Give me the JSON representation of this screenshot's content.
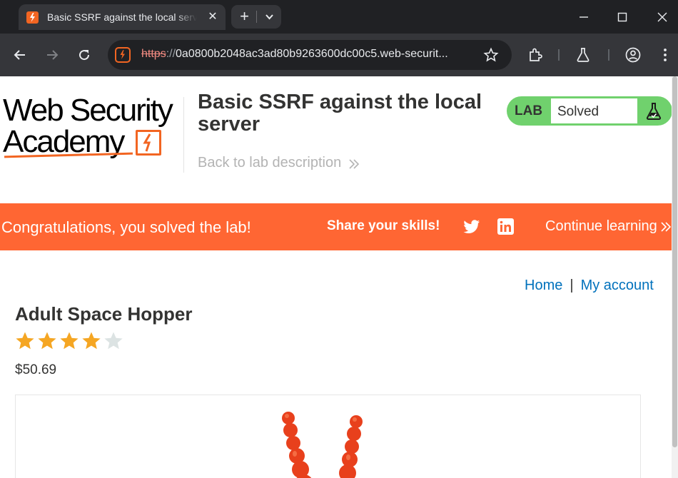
{
  "browser": {
    "tab_title": "Basic SSRF against the local server",
    "url_scheme": "https",
    "url_sep": "://",
    "url_rest": "0a0800b2048ac3ad80b9263600dc00c5.web-securit...",
    "tab_close_glyph": "✕",
    "newtab_glyph": "+"
  },
  "header": {
    "logo_line1": "Web Security",
    "logo_line2": "Academy",
    "lab_title": "Basic SSRF against the local server",
    "back_link": "Back to lab description",
    "lab_badge": "LAB",
    "lab_status": "Solved"
  },
  "banner": {
    "congrats": "Congratulations, you solved the lab!",
    "share": "Share your skills!",
    "continue": "Continue learning"
  },
  "nav": {
    "home": "Home",
    "separator": "|",
    "my_account": "My account"
  },
  "product": {
    "title": "Adult Space Hopper",
    "rating": 4,
    "rating_max": 5,
    "price": "$50.69"
  },
  "colors": {
    "accent": "#ff6633",
    "lab_green": "#70d16d",
    "link": "#0071bc",
    "star_on": "#f5a623",
    "star_off": "#dce3e3"
  },
  "icons": {
    "browser": [
      "site-favicon",
      "close-icon",
      "plus-icon",
      "chevron-down-icon",
      "minimize-icon",
      "maximize-icon",
      "window-close-icon",
      "back-arrow-icon",
      "forward-arrow-icon",
      "reload-icon",
      "site-info-icon",
      "bookmark-star-icon",
      "extensions-icon",
      "labs-flask-icon",
      "profile-icon",
      "menu-dots-icon"
    ],
    "page": [
      "academy-logo",
      "chevrons-right-icon",
      "flask-icon",
      "twitter-icon",
      "linkedin-icon",
      "star-icon"
    ]
  }
}
